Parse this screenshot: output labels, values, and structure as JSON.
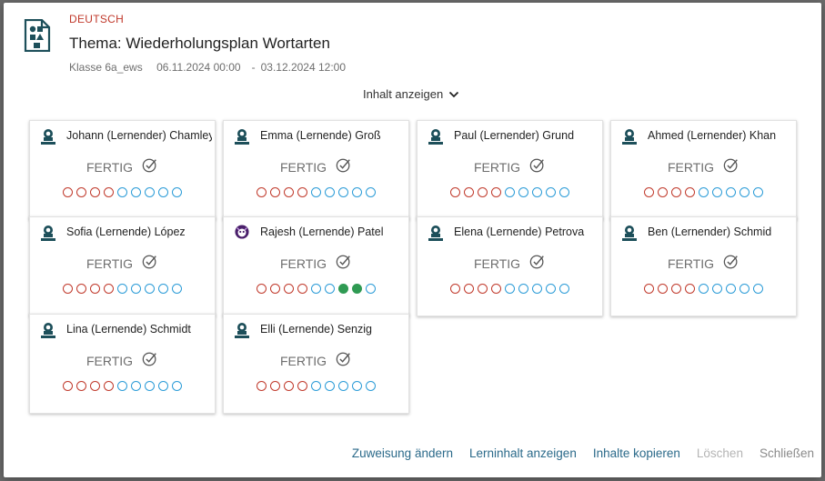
{
  "header": {
    "subject": "DEUTSCH",
    "title": "Thema: Wiederholungsplan Wortarten",
    "class": "Klasse 6a_ews",
    "date_start": "06.11.2024 00:00",
    "date_sep": "-",
    "date_end": "03.12.2024 12:00",
    "toggle_label": "Inhalt anzeigen"
  },
  "colors": {
    "accent": "#2b6a8a",
    "subject": "#c0392b",
    "incomplete_red": "#c0392b",
    "incomplete_blue": "#2a9bd7",
    "complete_green": "#2f9a53"
  },
  "students": [
    {
      "name": "Johann (Lernender) Chamley",
      "status": "FERTIG",
      "avatar": "default-avatar-icon",
      "dots": [
        "red",
        "red",
        "red",
        "red",
        "blue",
        "blue",
        "blue",
        "blue",
        "blue"
      ]
    },
    {
      "name": "Emma (Lernende) Groß",
      "status": "FERTIG",
      "avatar": "default-avatar-icon",
      "dots": [
        "red",
        "red",
        "red",
        "red",
        "blue",
        "blue",
        "blue",
        "blue",
        "blue"
      ]
    },
    {
      "name": "Paul (Lernender) Grund",
      "status": "FERTIG",
      "avatar": "default-avatar-icon",
      "dots": [
        "red",
        "red",
        "red",
        "red",
        "blue",
        "blue",
        "blue",
        "blue",
        "blue"
      ]
    },
    {
      "name": "Ahmed (Lernender) Khan",
      "status": "FERTIG",
      "avatar": "default-avatar-icon",
      "dots": [
        "red",
        "red",
        "red",
        "red",
        "blue",
        "blue",
        "blue",
        "blue",
        "blue"
      ]
    },
    {
      "name": "Sofia (Lernende) López",
      "status": "FERTIG",
      "avatar": "default-avatar-icon",
      "dots": [
        "red",
        "red",
        "red",
        "red",
        "blue",
        "blue",
        "blue",
        "blue",
        "blue"
      ]
    },
    {
      "name": "Rajesh (Lernende) Patel",
      "status": "FERTIG",
      "avatar": "monster-avatar-icon",
      "dots": [
        "red",
        "red",
        "red",
        "red",
        "blue",
        "blue",
        "done",
        "done",
        "blue"
      ]
    },
    {
      "name": "Elena (Lernende) Petrova",
      "status": "FERTIG",
      "avatar": "default-avatar-icon",
      "dots": [
        "red",
        "red",
        "red",
        "red",
        "blue",
        "blue",
        "blue",
        "blue",
        "blue"
      ]
    },
    {
      "name": "Ben (Lernender) Schmid",
      "status": "FERTIG",
      "avatar": "default-avatar-icon",
      "dots": [
        "red",
        "red",
        "red",
        "red",
        "blue",
        "blue",
        "blue",
        "blue",
        "blue"
      ]
    },
    {
      "name": "Lina (Lernende) Schmidt",
      "status": "FERTIG",
      "avatar": "default-avatar-icon",
      "dots": [
        "red",
        "red",
        "red",
        "red",
        "blue",
        "blue",
        "blue",
        "blue",
        "blue"
      ]
    },
    {
      "name": "Elli (Lernende) Senzig",
      "status": "FERTIG",
      "avatar": "default-avatar-icon",
      "dots": [
        "red",
        "red",
        "red",
        "red",
        "blue",
        "blue",
        "blue",
        "blue",
        "blue"
      ]
    }
  ],
  "footer": {
    "change_assignment": "Zuweisung ändern",
    "show_content": "Lerninhalt anzeigen",
    "copy_content": "Inhalte kopieren",
    "delete": "Löschen",
    "close": "Schließen"
  }
}
